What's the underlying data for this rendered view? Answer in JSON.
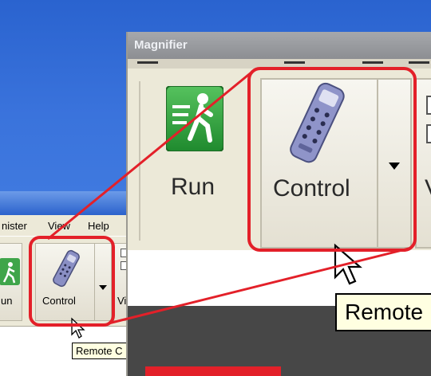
{
  "magnifier": {
    "title": "Magnifier",
    "buttons": {
      "run_label": "Run",
      "control_label": "Control",
      "partial_label": "V"
    },
    "tooltip": "Remote"
  },
  "app": {
    "menu": {
      "administer": "nister",
      "view": "View",
      "help": "Help"
    },
    "toolbar": {
      "run_label": "un",
      "control_label": "Control",
      "partial_label": "Vi"
    },
    "tooltip": "Remote C"
  },
  "colors": {
    "highlight": "#e32029",
    "desktop": "#3a73dc",
    "window_face": "#ece9d8",
    "tooltip_bg": "#ffffe1"
  },
  "icons": [
    "run-icon",
    "remote-control-icon",
    "dropdown-arrow-icon",
    "mouse-pointer-icon"
  ]
}
